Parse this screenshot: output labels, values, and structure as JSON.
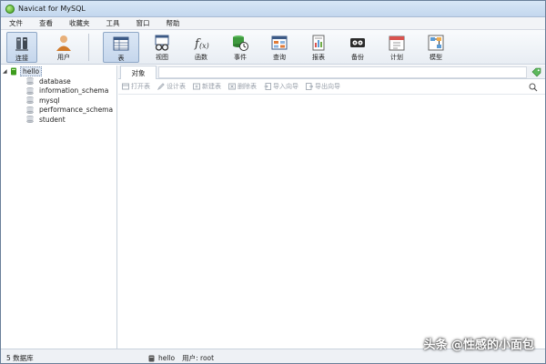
{
  "window": {
    "title": "Navicat for MySQL"
  },
  "menu": [
    "文件",
    "查看",
    "收藏夹",
    "工具",
    "窗口",
    "帮助"
  ],
  "toolbar": [
    {
      "label": "连接",
      "icon": "connection-icon"
    },
    {
      "label": "用户",
      "icon": "user-icon"
    },
    {
      "label": "表",
      "icon": "table-icon",
      "active": true
    },
    {
      "label": "视图",
      "icon": "view-icon"
    },
    {
      "label": "函数",
      "icon": "function-icon"
    },
    {
      "label": "事件",
      "icon": "event-icon"
    },
    {
      "label": "查询",
      "icon": "query-icon"
    },
    {
      "label": "报表",
      "icon": "report-icon"
    },
    {
      "label": "备份",
      "icon": "backup-icon"
    },
    {
      "label": "计划",
      "icon": "schedule-icon"
    },
    {
      "label": "模型",
      "icon": "model-icon"
    }
  ],
  "tree": {
    "connection": "hello",
    "databases": [
      "database",
      "information_schema",
      "mysql",
      "performance_schema",
      "student"
    ]
  },
  "tabs": {
    "objects": "对象"
  },
  "object_toolbar": [
    "打开表",
    "设计表",
    "新建表",
    "删除表",
    "导入向导",
    "导出向导"
  ],
  "status": {
    "db_count": "5 数据库",
    "connection": "hello",
    "user": "用户: root"
  },
  "watermark": "头条 @性感的小面包",
  "colors": {
    "accent": "#c5d6ec",
    "window_border": "#6a7f99"
  }
}
